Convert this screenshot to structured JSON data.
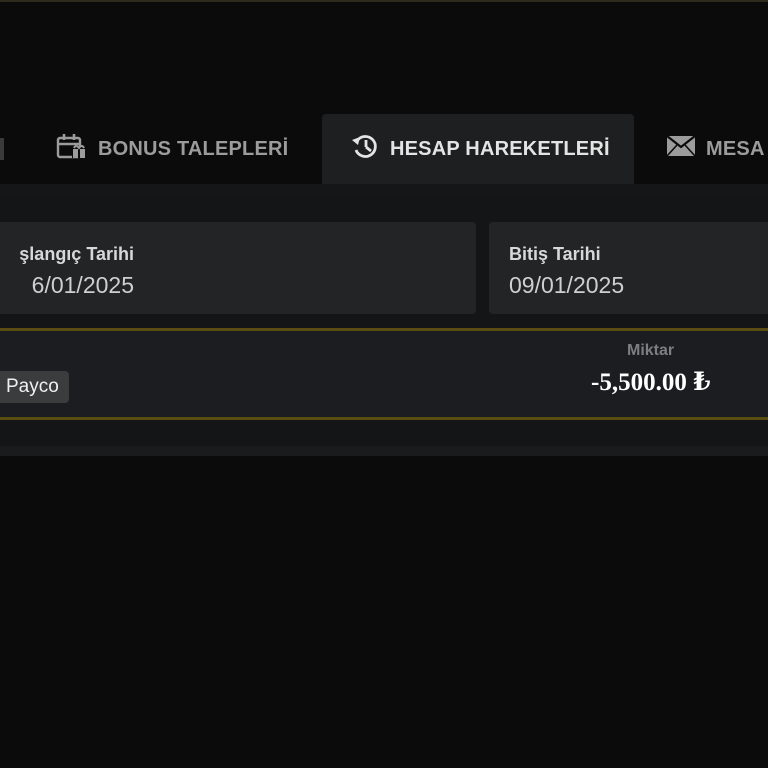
{
  "tabs": [
    {
      "label": "BONUS TALEPLERİ",
      "icon": "gift-calendar-icon",
      "active": false
    },
    {
      "label": "HESAP HAREKETLERİ",
      "icon": "history-icon",
      "active": true
    },
    {
      "label": "MESA",
      "icon": "envelope-icon",
      "active": false
    }
  ],
  "filters": {
    "start": {
      "label": "şlangıç Tarihi",
      "value": "6/01/2025"
    },
    "end": {
      "label": "Bitiş Tarihi",
      "value": "09/01/2025"
    }
  },
  "transaction": {
    "method": "Payco",
    "amount_label": "Miktar",
    "amount": "-5,500.00 ₺"
  },
  "colors": {
    "background": "#0b0b0b",
    "active_tab": "#1e1f20",
    "card_border": "#5a4d12",
    "amount_text": "#ffffff"
  }
}
